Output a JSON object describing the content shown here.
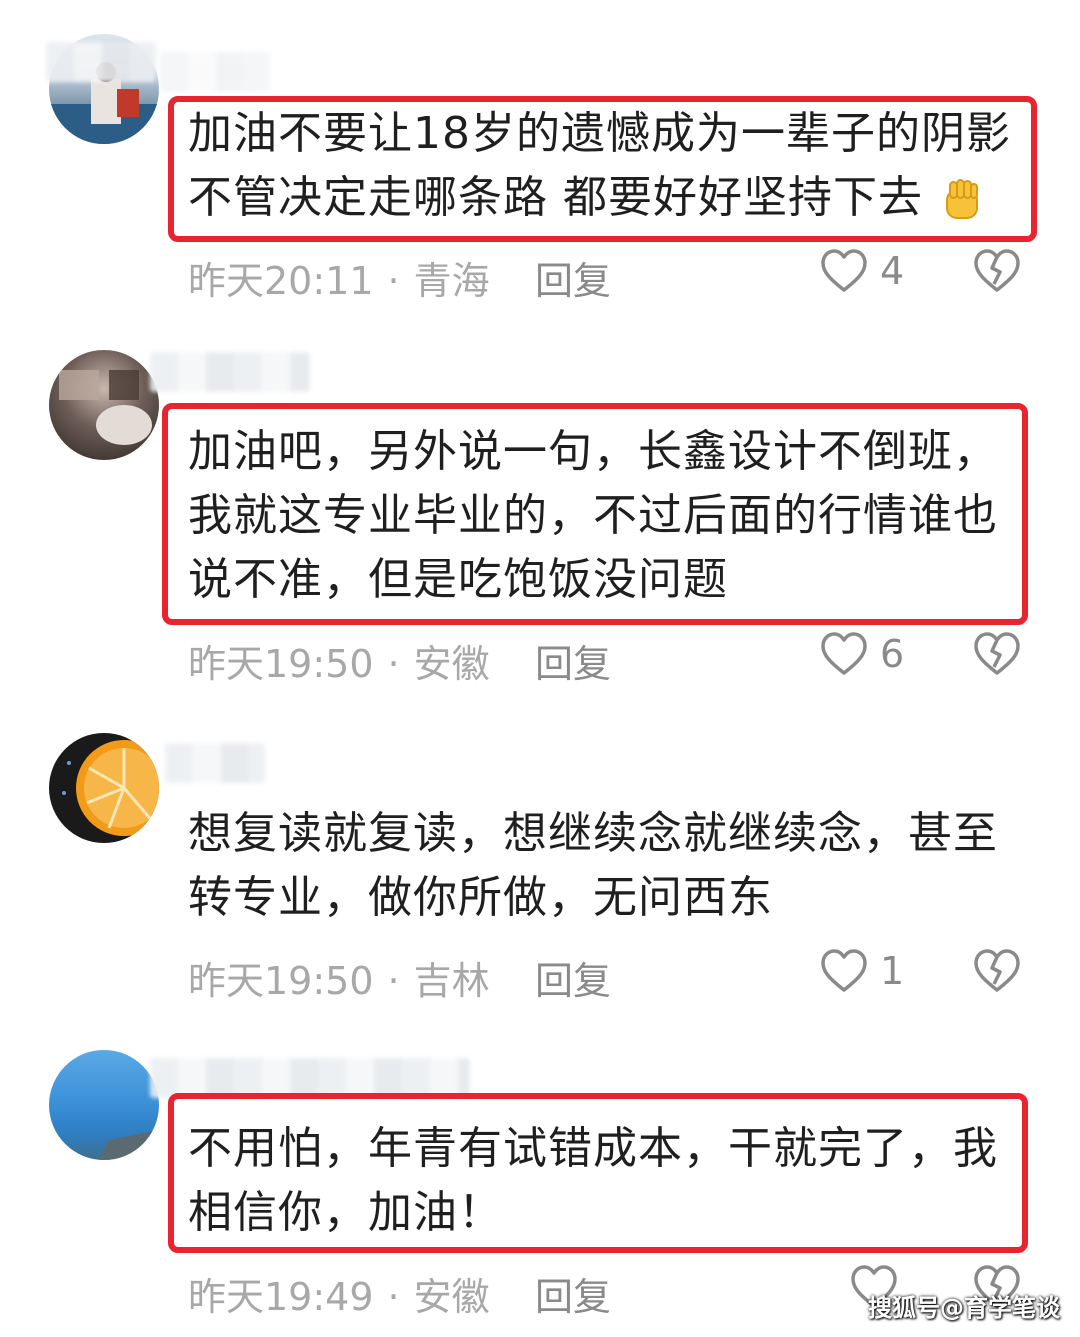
{
  "comments": [
    {
      "lines": [
        "加油不要让18岁的遗憾成为一辈子的阴影",
        "不管决定走哪条路 都要好好坚持下去"
      ],
      "emoji": "raised-fist-emoji",
      "time": "昨天20:11",
      "location": "青海",
      "reply": "回复",
      "likes": "4",
      "highlighted": true
    },
    {
      "lines": [
        "加油吧，另外说一句，长鑫设计不倒班，",
        "我就这专业毕业的，不过后面的行情谁也",
        "说不准，但是吃饱饭没问题"
      ],
      "time": "昨天19:50",
      "location": "安徽",
      "reply": "回复",
      "likes": "6",
      "highlighted": true
    },
    {
      "lines": [
        "想复读就复读，想继续念就继续念，甚至",
        "转专业，做你所做，无问西东"
      ],
      "time": "昨天19:50",
      "location": "吉林",
      "reply": "回复",
      "likes": "1",
      "highlighted": false
    },
    {
      "lines": [
        "不用怕，年青有试错成本，干就完了，我",
        "相信你，加油！"
      ],
      "time": "昨天19:49",
      "location": "安徽",
      "reply": "回复",
      "likes": "",
      "highlighted": true
    }
  ],
  "separator": "·",
  "icons": {
    "like": "heart-outline-icon",
    "dislike": "broken-heart-icon"
  },
  "colors": {
    "highlight": "#e8242f",
    "meta": "#a8a8a8",
    "text": "#1f1f1f"
  },
  "watermark": "搜狐号@育学笔谈"
}
